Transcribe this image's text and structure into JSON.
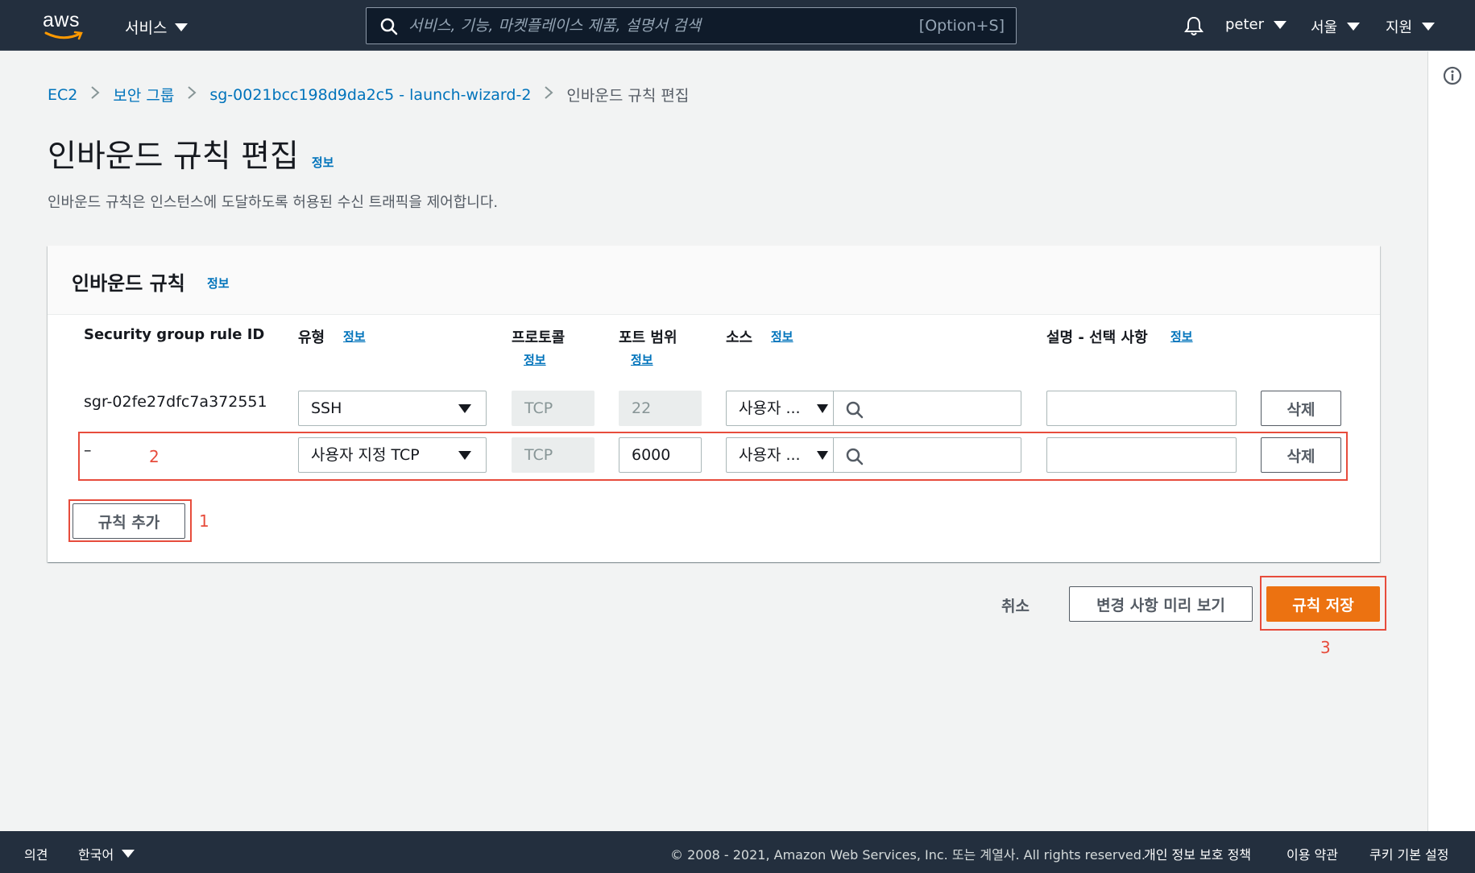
{
  "topnav": {
    "logo_text": "aws",
    "services_label": "서비스",
    "search_placeholder": "서비스, 기능, 마켓플레이스 제품, 설명서 검색",
    "search_shortcut": "[Option+S]",
    "user_label": "peter",
    "region_label": "서울",
    "support_label": "지원",
    "bg_color": "#232f3e"
  },
  "breadcrumb": {
    "items": [
      "EC2",
      "보안 그룹",
      "sg-0021bcc198d9da2c5 - launch-wizard-2"
    ],
    "current": "인바운드 규칙 편집"
  },
  "page": {
    "title": "인바운드 규칙 편집",
    "title_info": "정보",
    "description": "인바운드 규칙은 인스턴스에 도달하도록 허용된 수신 트래픽을 제어합니다."
  },
  "panel": {
    "title": "인바운드 규칙",
    "title_info": "정보",
    "columns": {
      "rule_id": "Security group rule ID",
      "type": "유형",
      "type_info": "정보",
      "protocol": "프로토콜",
      "protocol_info": "정보",
      "port_range": "포트 범위",
      "port_info": "정보",
      "source": "소스",
      "source_info": "정보",
      "description": "설명 - 선택 사항",
      "description_info": "정보"
    },
    "rows": [
      {
        "rule_id": "sgr-02fe27dfc7a372551",
        "type": "SSH",
        "protocol": "TCP",
        "port": "22",
        "source_type": "사용자 ...",
        "description": "",
        "delete_label": "삭제"
      },
      {
        "rule_id": "–",
        "type": "사용자 지정 TCP",
        "protocol": "TCP",
        "port": "6000",
        "source_type": "사용자 ...",
        "description": "",
        "delete_label": "삭제"
      }
    ],
    "add_rule_label": "규칙 추가"
  },
  "actions": {
    "cancel_label": "취소",
    "preview_label": "변경 사항 미리 보기",
    "save_label": "규칙 저장",
    "primary_color": "#ec7211"
  },
  "annotations": {
    "add_rule": "1",
    "new_row": "2",
    "save": "3",
    "color": "#e74c3c"
  },
  "footer": {
    "feedback_label": "의견",
    "language_label": "한국어",
    "copyright": "© 2008 - 2021, Amazon Web Services, Inc. 또는 계열사. All rights reserved.",
    "privacy_label": "개인 정보 보호 정책",
    "terms_label": "이용 약관",
    "cookie_label": "쿠키 기본 설정"
  }
}
